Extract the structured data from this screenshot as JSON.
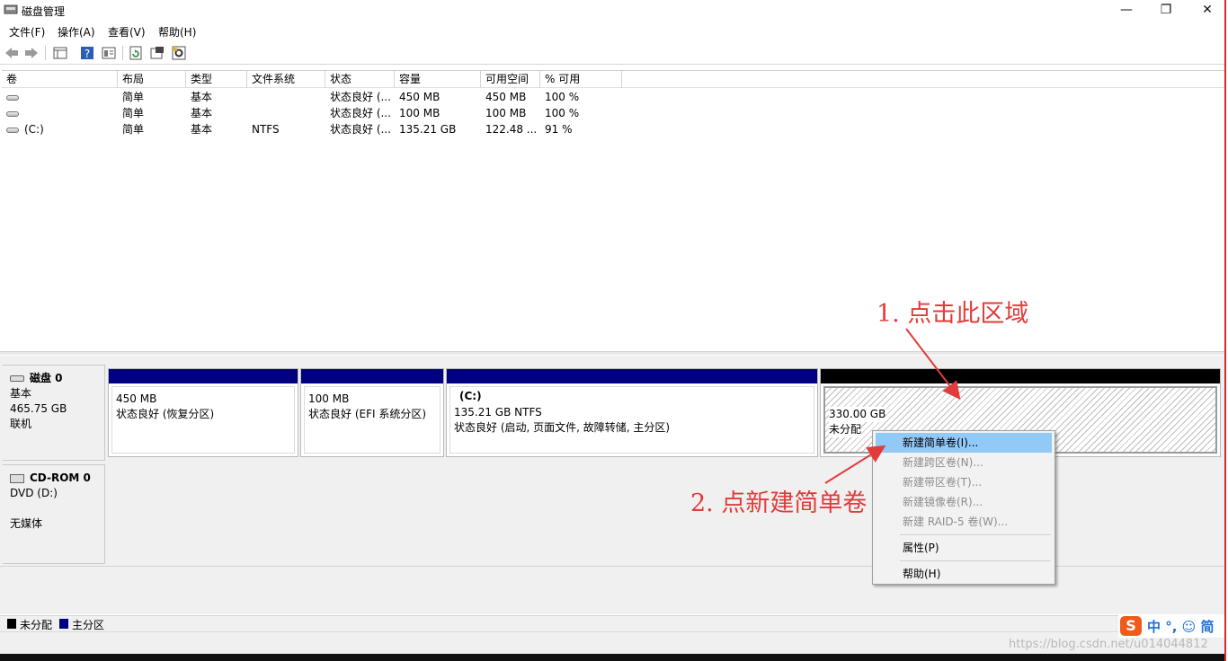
{
  "window": {
    "title": "磁盘管理"
  },
  "menu": [
    "文件(F)",
    "操作(A)",
    "查看(V)",
    "帮助(H)"
  ],
  "list": {
    "columns": [
      "卷",
      "布局",
      "类型",
      "文件系统",
      "状态",
      "容量",
      "可用空间",
      "% 可用"
    ],
    "rows": [
      [
        "",
        "简单",
        "基本",
        "",
        "状态良好 (...",
        "450 MB",
        "450 MB",
        "100 %"
      ],
      [
        "",
        "简单",
        "基本",
        "",
        "状态良好 (...",
        "100 MB",
        "100 MB",
        "100 %"
      ],
      [
        "(C:)",
        "简单",
        "基本",
        "NTFS",
        "状态良好 (...",
        "135.21 GB",
        "122.48 ...",
        "91 %"
      ]
    ]
  },
  "disk0": {
    "name": "磁盘 0",
    "type": "基本",
    "size": "465.75 GB",
    "status": "联机",
    "partitions": [
      {
        "title": "",
        "size": "450 MB",
        "status": "状态良好 (恢复分区)"
      },
      {
        "title": "",
        "size": "100 MB",
        "status": "状态良好 (EFI 系统分区)"
      },
      {
        "title": "(C:)",
        "size": "135.21 GB NTFS",
        "status": "状态良好 (启动, 页面文件, 故障转储, 主分区)"
      },
      {
        "title": "",
        "size": "330.00 GB",
        "status": "未分配"
      }
    ]
  },
  "cdrom": {
    "name": "CD-ROM 0",
    "drive": "DVD (D:)",
    "media": "无媒体"
  },
  "legend": [
    {
      "label": "未分配",
      "color": "#000000"
    },
    {
      "label": "主分区",
      "color": "#000080"
    }
  ],
  "context_menu": {
    "items": [
      {
        "label": "新建简单卷(I)...",
        "state": "highlighted"
      },
      {
        "label": "新建跨区卷(N)...",
        "state": "disabled"
      },
      {
        "label": "新建带区卷(T)...",
        "state": "disabled"
      },
      {
        "label": "新建镜像卷(R)...",
        "state": "disabled"
      },
      {
        "label": "新建 RAID-5 卷(W)...",
        "state": "disabled"
      },
      {
        "label": "属性(P)",
        "state": "enabled"
      },
      {
        "label": "帮助(H)",
        "state": "enabled"
      }
    ]
  },
  "annotations": {
    "step1": "1. 点击此区域",
    "step2": "2. 点新建简单卷",
    "color": "#e23b3b"
  },
  "ime": {
    "logo": "S",
    "text": "中 °, ☺ 简"
  },
  "watermark": "https://blog.csdn.net/u014044812",
  "toolbar_icons": [
    "back-icon",
    "forward-icon",
    "show-hide-tree-icon",
    "help-icon",
    "properties-icon",
    "refresh-icon",
    "rescan-icon",
    "settings-icon"
  ]
}
